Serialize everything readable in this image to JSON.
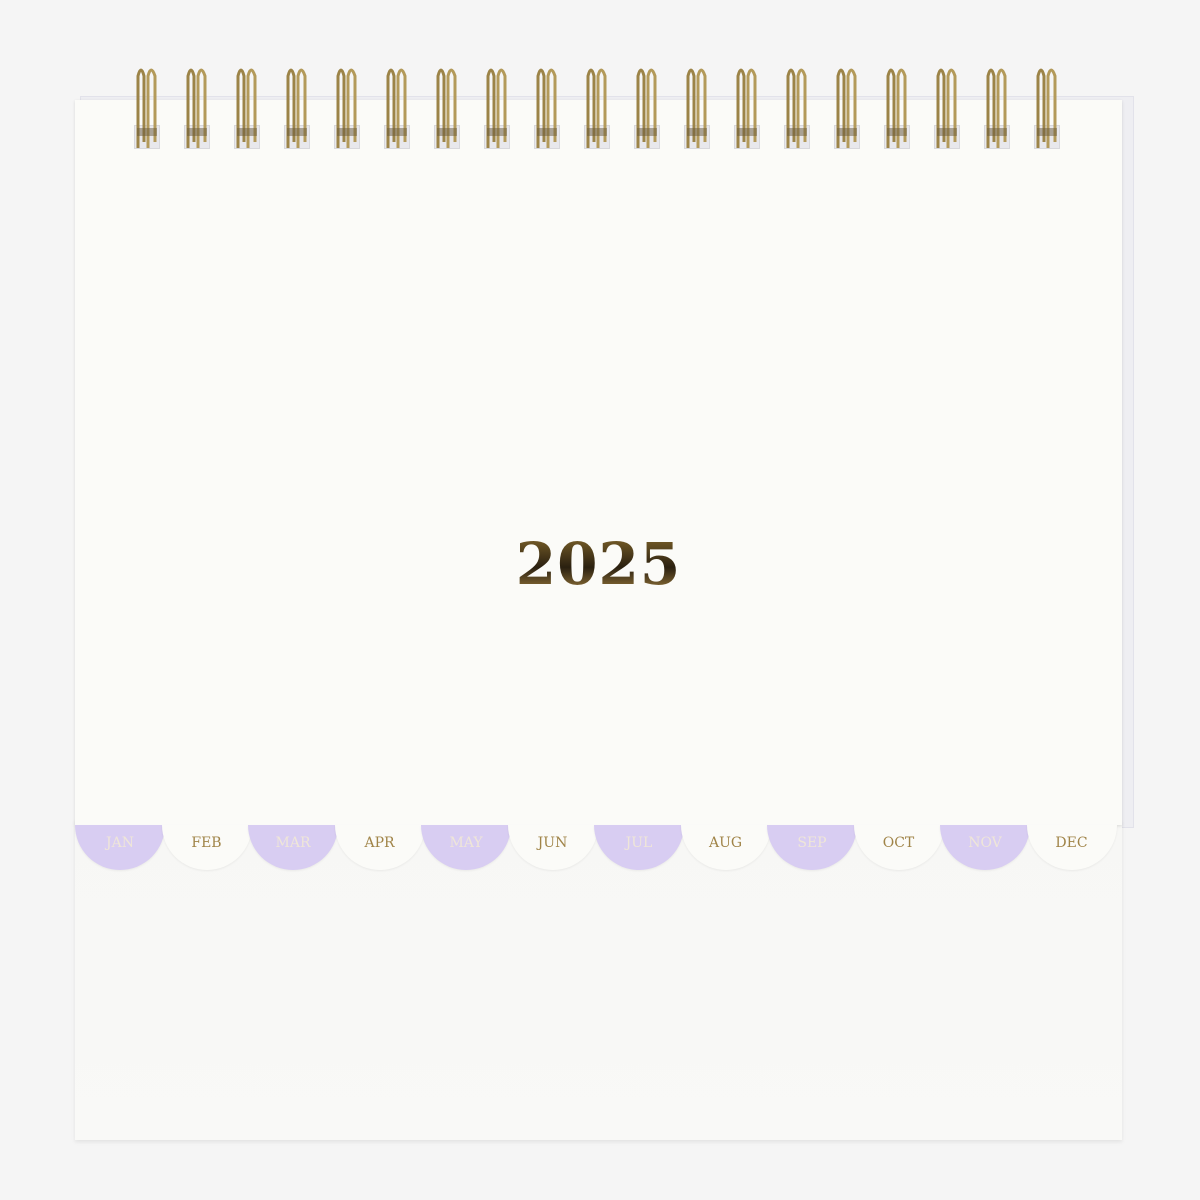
{
  "calendar": {
    "year": "2025",
    "months": [
      "JAN",
      "FEB",
      "MAR",
      "APR",
      "MAY",
      "JUN",
      "JUL",
      "AUG",
      "SEP",
      "OCT",
      "NOV",
      "DEC"
    ],
    "ring_count": 19,
    "colors": {
      "tab_purple": "#d8cdf2",
      "tab_white": "#fbfbf8",
      "gold": "#a08448",
      "paper": "#fbfbf8"
    }
  }
}
